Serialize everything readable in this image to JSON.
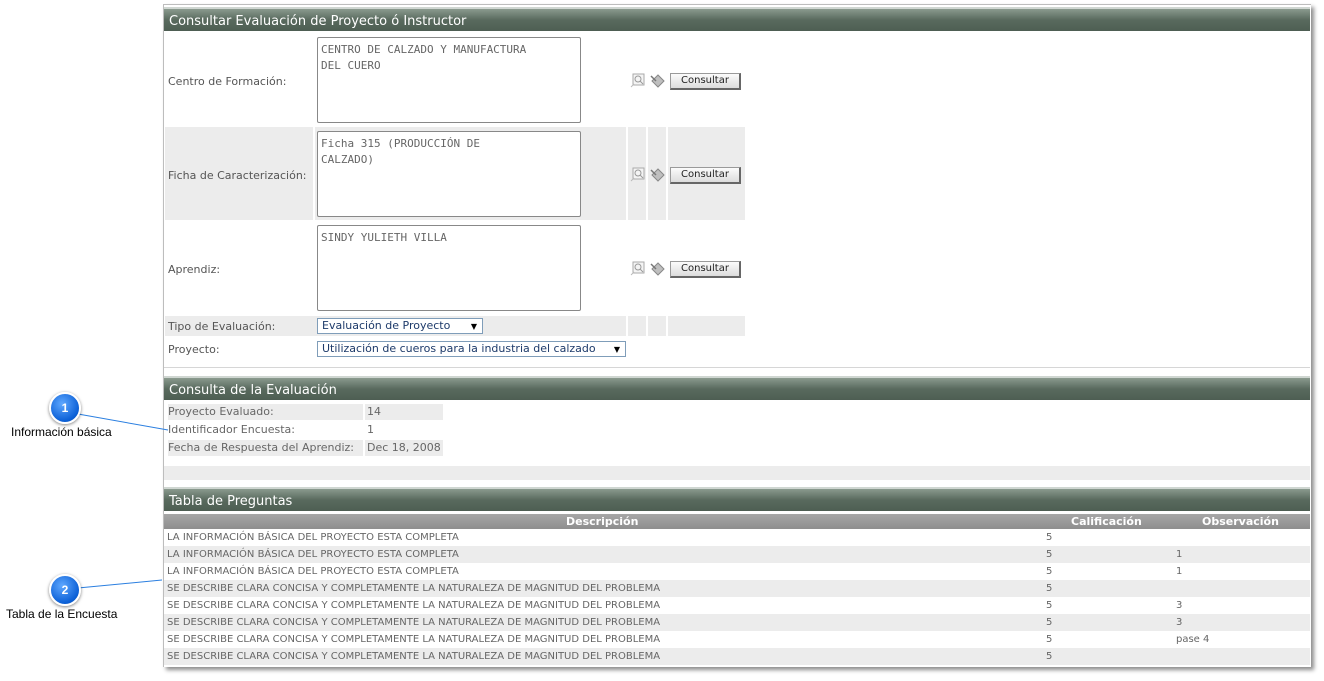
{
  "section1": {
    "title": "Consultar Evaluación de Proyecto ó Instructor",
    "centro": {
      "label": "Centro de Formación:",
      "value": "CENTRO DE CALZADO Y MANUFACTURA\nDEL CUERO",
      "button": "Consultar"
    },
    "ficha": {
      "label": "Ficha de Caracterización:",
      "value": "Ficha 315 (PRODUCCIÓN DE\nCALZADO)",
      "button": "Consultar"
    },
    "aprendiz": {
      "label": "Aprendiz:",
      "value": "SINDY YULIETH VILLA",
      "button": "Consultar"
    },
    "tipo": {
      "label": "Tipo de Evaluación:",
      "value": "Evaluación de Proyecto"
    },
    "proyecto": {
      "label": "Proyecto:",
      "value": "Utilización de cueros para la industria del calzado"
    }
  },
  "section2": {
    "title": "Consulta de la Evaluación",
    "rows": [
      {
        "key": "Proyecto Evaluado:",
        "value": "14"
      },
      {
        "key": "Identificador Encuesta:",
        "value": "1"
      },
      {
        "key": "Fecha de Respuesta del Aprendiz:",
        "value": "Dec 18, 2008"
      }
    ]
  },
  "section3": {
    "title": "Tabla de Preguntas",
    "headers": {
      "descripcion": "Descripción",
      "calificacion": "Calificación",
      "observacion": "Observación"
    },
    "rows": [
      {
        "d": "LA INFORMACIÓN BÁSICA DEL PROYECTO ESTA COMPLETA",
        "c": "5",
        "o": ""
      },
      {
        "d": "LA INFORMACIÓN BÁSICA DEL PROYECTO ESTA COMPLETA",
        "c": "5",
        "o": "1"
      },
      {
        "d": "LA INFORMACIÓN BÁSICA DEL PROYECTO ESTA COMPLETA",
        "c": "5",
        "o": "1"
      },
      {
        "d": "SE DESCRIBE CLARA CONCISA Y COMPLETAMENTE LA NATURALEZA DE MAGNITUD DEL PROBLEMA",
        "c": "5",
        "o": ""
      },
      {
        "d": "SE DESCRIBE CLARA CONCISA Y COMPLETAMENTE LA NATURALEZA DE MAGNITUD DEL PROBLEMA",
        "c": "5",
        "o": "3"
      },
      {
        "d": "SE DESCRIBE CLARA CONCISA Y COMPLETAMENTE LA NATURALEZA DE MAGNITUD DEL PROBLEMA",
        "c": "5",
        "o": "3"
      },
      {
        "d": "SE DESCRIBE CLARA CONCISA Y COMPLETAMENTE LA NATURALEZA DE MAGNITUD DEL PROBLEMA",
        "c": "5",
        "o": "pase 4"
      },
      {
        "d": "SE DESCRIBE CLARA CONCISA Y COMPLETAMENTE LA NATURALEZA DE MAGNITUD DEL PROBLEMA",
        "c": "5",
        "o": ""
      }
    ]
  },
  "callouts": [
    {
      "number": "1",
      "label": "Información básica"
    },
    {
      "number": "2",
      "label": "Tabla de la Encuesta"
    }
  ],
  "colors": {
    "header_green": "#596a5e",
    "callout_blue": "#0a5fd6",
    "row_alt": "#ececec"
  },
  "icons": {
    "search": "magnifier-icon",
    "clear": "eraser-icon"
  }
}
